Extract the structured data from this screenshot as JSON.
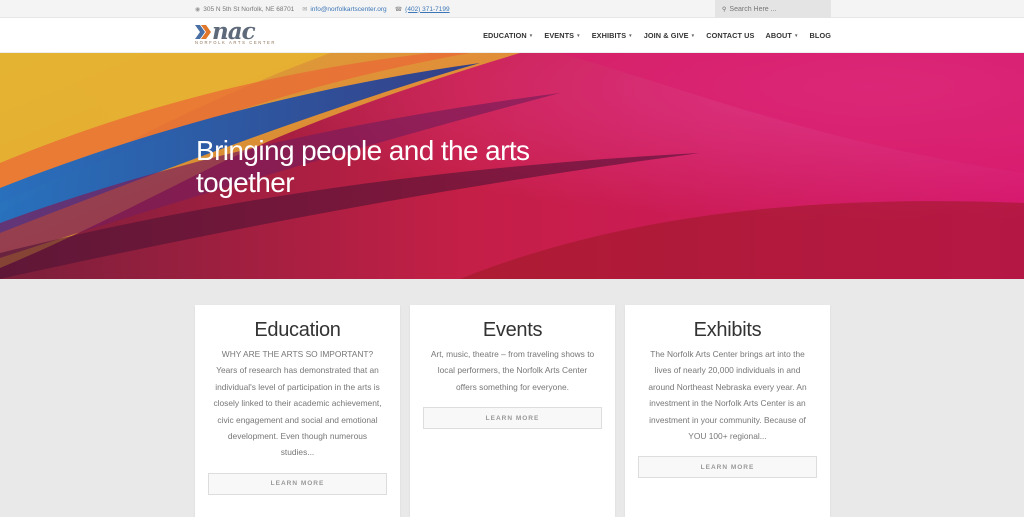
{
  "topbar": {
    "address": "305 N 5th St Norfolk, NE 68701",
    "email": "info@norfolkartscenter.org",
    "phone": "(402) 371-7199",
    "search_placeholder": "Search Here ..."
  },
  "logo": {
    "mark": "nac",
    "subtitle": "NORFOLK ARTS CENTER"
  },
  "nav": {
    "items": [
      {
        "label": "EDUCATION",
        "has_dropdown": true
      },
      {
        "label": "EVENTS",
        "has_dropdown": true
      },
      {
        "label": "EXHIBITS",
        "has_dropdown": true
      },
      {
        "label": "JOIN & GIVE",
        "has_dropdown": true
      },
      {
        "label": "CONTACT US",
        "has_dropdown": false
      },
      {
        "label": "ABOUT",
        "has_dropdown": true
      },
      {
        "label": "BLOG",
        "has_dropdown": false
      }
    ]
  },
  "hero": {
    "title": "Bringing people and the arts together"
  },
  "cards": [
    {
      "title": "Education",
      "text": "WHY ARE THE ARTS SO IMPORTANT? Years of research has demonstrated that an individual's level of participation in the arts is closely linked to their academic achievement, civic engagement and social and emotional development. Even though numerous studies...",
      "button": "LEARN MORE"
    },
    {
      "title": "Events",
      "text": "Art, music, theatre – from traveling shows to local performers, the Norfolk Arts Center offers something for everyone.",
      "button": "LEARN MORE"
    },
    {
      "title": "Exhibits",
      "text": "The Norfolk Arts Center brings art into the lives of nearly 20,000 individuals in and around Northeast Nebraska every year.  An investment in the Norfolk Arts Center is an investment in your community. Because of YOU 100+ regional...",
      "button": "LEARN MORE"
    }
  ],
  "colors": {
    "link": "#3d76b7",
    "logo_chevron": "#e0762a",
    "logo_chevron_blue": "#4a6fa5"
  }
}
